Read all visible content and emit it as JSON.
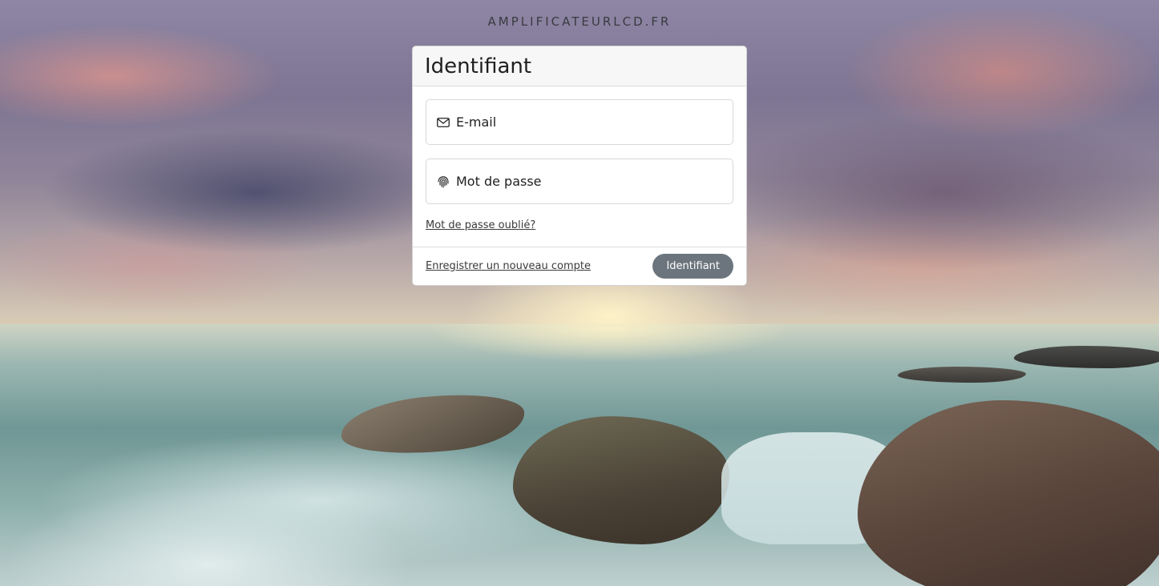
{
  "site": {
    "title": "AMPLIFICATEURLCD.FR"
  },
  "login": {
    "heading": "Identifiant",
    "email": {
      "placeholder": "E-mail",
      "value": "",
      "icon": "envelope-icon"
    },
    "password": {
      "placeholder": "Mot de passe",
      "value": "",
      "icon": "fingerprint-icon"
    },
    "forgot_password_link": "Mot de passe oublié?",
    "register_link": "Enregistrer un nouveau compte",
    "submit_label": "Identifiant"
  },
  "colors": {
    "submit_button": "#6c757d",
    "card_header_bg": "#f7f7f7"
  }
}
